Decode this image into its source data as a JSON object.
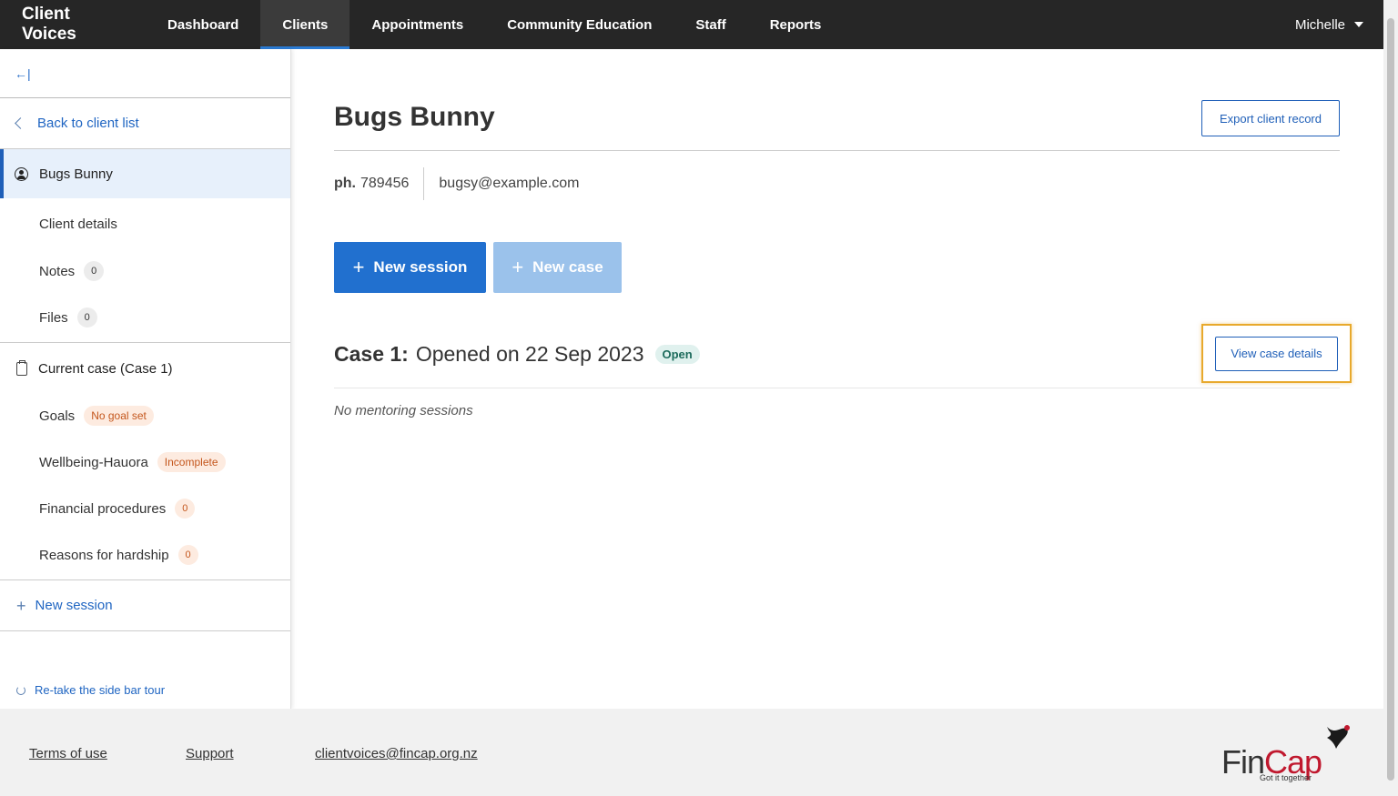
{
  "nav": {
    "brand": "Client Voices",
    "tabs": [
      "Dashboard",
      "Clients",
      "Appointments",
      "Community Education",
      "Staff",
      "Reports"
    ],
    "active_tab": "Clients",
    "user": "Michelle"
  },
  "sidebar": {
    "collapse_glyph": "←|",
    "back_label": "Back to client list",
    "client_name": "Bugs Bunny",
    "client_items": [
      {
        "label": "Client details"
      },
      {
        "label": "Notes",
        "count": "0"
      },
      {
        "label": "Files",
        "count": "0"
      }
    ],
    "current_case_label": "Current case (Case 1)",
    "case_items": [
      {
        "label": "Goals",
        "badge": "No goal set"
      },
      {
        "label": "Wellbeing-Hauora",
        "badge": "Incomplete"
      },
      {
        "label": "Financial procedures",
        "count": "0"
      },
      {
        "label": "Reasons for hardship",
        "count": "0"
      }
    ],
    "new_session_label": "New session",
    "tour_label": "Re-take the side bar tour"
  },
  "main": {
    "client_name": "Bugs Bunny",
    "export_label": "Export client record",
    "phone_label": "ph.",
    "phone": "789456",
    "email": "bugsy@example.com",
    "new_session_label": "New session",
    "new_case_label": "New case",
    "case_heading": "Case 1:",
    "case_opened": "Opened on 22 Sep 2023",
    "case_status": "Open",
    "view_case_label": "View case details",
    "no_sessions": "No mentoring sessions"
  },
  "footer": {
    "terms": "Terms of use",
    "support": "Support",
    "email": "clientvoices@fincap.org.nz",
    "logo_fin": "Fin",
    "logo_cap": "Cap",
    "logo_tagline": "Got it together"
  },
  "colors": {
    "nav_bg": "#262626",
    "primary": "#2170cf",
    "link": "#1f65c2",
    "highlight": "#e8a92c",
    "badge_orange": "#c4561c",
    "logo_red": "#c0182e"
  },
  "icons": [
    "collapse-sidebar-icon",
    "chevron-left-icon",
    "person-icon",
    "clipboard-icon",
    "plus-icon",
    "refresh-icon",
    "caret-down-icon",
    "bird-icon"
  ]
}
